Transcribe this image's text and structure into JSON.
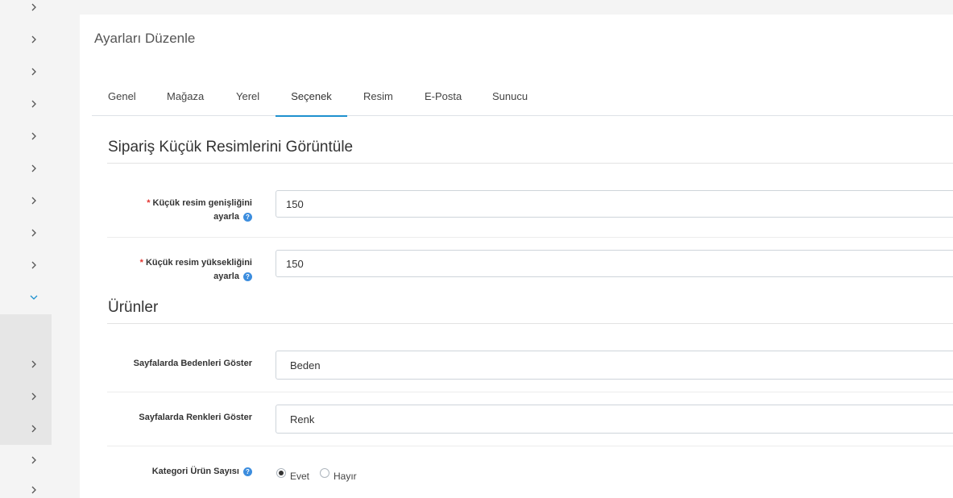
{
  "page": {
    "title": "Ayarları Düzenle"
  },
  "tabs": [
    {
      "label": "Genel"
    },
    {
      "label": "Mağaza"
    },
    {
      "label": "Yerel"
    },
    {
      "label": "Seçenek",
      "active": true
    },
    {
      "label": "Resim"
    },
    {
      "label": "E-Posta"
    },
    {
      "label": "Sunucu"
    }
  ],
  "sections": {
    "order_thumbs": {
      "title": "Sipariş Küçük Resimlerini Görüntüle",
      "width_label_1": "Küçük resim genişliğini",
      "width_label_2": "ayarla",
      "width_value": "150",
      "height_label_1": "Küçük resim yüksekliğini",
      "height_label_2": "ayarla",
      "height_value": "150",
      "required_mark": "*"
    },
    "products": {
      "title": "Ürünler",
      "sizes_label": "Sayfalarda Bedenleri Göster",
      "sizes_value": "Beden",
      "colors_label": "Sayfalarda Renkleri Göster",
      "colors_value": "Renk",
      "count_label": "Kategori Ürün Sayısı",
      "count_options": [
        "Evet",
        "Hayır"
      ],
      "count_selected": "Evet"
    }
  },
  "help_glyph": "?",
  "icons": {
    "sidebar_chevron": "chevron-right-icon",
    "sidebar_expanded": "chevron-down-icon",
    "help": "help-icon"
  },
  "colors": {
    "accent": "#1e91cf",
    "help": "#3c8dde",
    "required": "#e3342f"
  }
}
